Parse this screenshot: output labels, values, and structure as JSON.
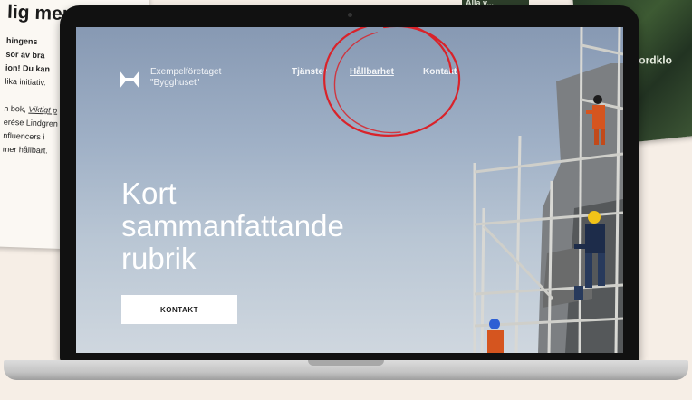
{
  "background": {
    "paper_heading": "lig mer?",
    "paper_lines": [
      {
        "text": "hingens",
        "bold": true
      },
      {
        "text": "sor av bra",
        "bold": true
      },
      {
        "text": "ion! Du kan",
        "bold": true
      },
      {
        "text": "lika initiativ.",
        "bold": false
      },
      {
        "text": "",
        "bold": false
      },
      {
        "text": "n bok, ",
        "bold": false,
        "link": "Viktigt p"
      },
      {
        "text": "erése Lindgren",
        "bold": false
      },
      {
        "text": "nfluencers i",
        "bold": false
      },
      {
        "text": "mer hållbart.",
        "bold": false
      }
    ],
    "map_label": "jordklo",
    "top_label": "Alla v..."
  },
  "site": {
    "logo_text": "Exempelföretaget \"Bygghuset\"",
    "nav": [
      {
        "label": "Tjänster",
        "active": false
      },
      {
        "label": "Hållbarhet",
        "active": true
      },
      {
        "label": "Kontakt",
        "active": false
      }
    ],
    "hero_title": "Kort sammanfattande rubrik",
    "cta_label": "KONTAKT"
  },
  "colors": {
    "sky": "#9fb0c6",
    "annotation": "#d9232a",
    "laptop": "#111111"
  }
}
